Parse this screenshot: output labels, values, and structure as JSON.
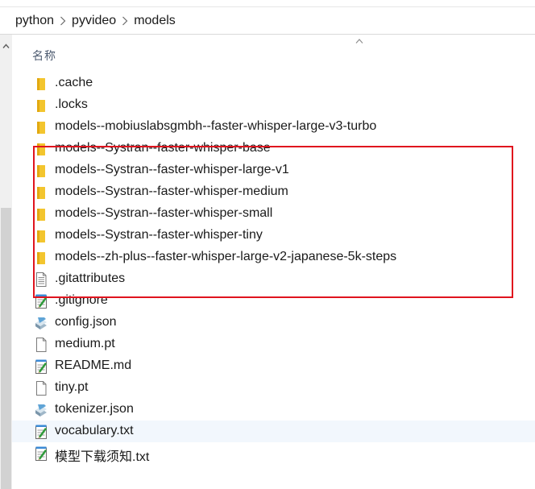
{
  "breadcrumb": [
    "python",
    "pyvideo",
    "models"
  ],
  "column_header": "名称",
  "highlight_color": "#e0141e",
  "selected_row_color": "#f2f7fd",
  "files": [
    {
      "name": ".cache",
      "icon": "folder-icon"
    },
    {
      "name": ".locks",
      "icon": "folder-icon"
    },
    {
      "name": "models--mobiuslabsgmbh--faster-whisper-large-v3-turbo",
      "icon": "folder-icon"
    },
    {
      "name": "models--Systran--faster-whisper-base",
      "icon": "folder-icon"
    },
    {
      "name": "models--Systran--faster-whisper-large-v1",
      "icon": "folder-icon"
    },
    {
      "name": "models--Systran--faster-whisper-medium",
      "icon": "folder-icon"
    },
    {
      "name": "models--Systran--faster-whisper-small",
      "icon": "folder-icon"
    },
    {
      "name": "models--Systran--faster-whisper-tiny",
      "icon": "folder-icon"
    },
    {
      "name": "models--zh-plus--faster-whisper-large-v2-japanese-5k-steps",
      "icon": "folder-icon"
    },
    {
      "name": ".gitattributes",
      "icon": "text-file-icon"
    },
    {
      "name": ".gitignore",
      "icon": "notepad-file-icon"
    },
    {
      "name": "config.json",
      "icon": "json-file-icon"
    },
    {
      "name": "medium.pt",
      "icon": "blank-file-icon"
    },
    {
      "name": "README.md",
      "icon": "notepad-file-icon"
    },
    {
      "name": "tiny.pt",
      "icon": "blank-file-icon"
    },
    {
      "name": "tokenizer.json",
      "icon": "json-file-icon"
    },
    {
      "name": "vocabulary.txt",
      "icon": "notepad-file-icon",
      "selected": true
    },
    {
      "name": "模型下载须知.txt",
      "icon": "notepad-file-icon"
    }
  ]
}
